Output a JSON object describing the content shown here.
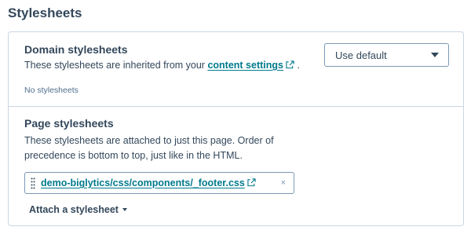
{
  "page": {
    "title": "Stylesheets"
  },
  "domain": {
    "title": "Domain stylesheets",
    "desc_prefix": "These stylesheets are inherited from your ",
    "link_text": "content settings",
    "desc_suffix": " .",
    "empty_text": "No stylesheets",
    "select_value": "Use default"
  },
  "page_styles": {
    "title": "Page stylesheets",
    "desc_line1": "These stylesheets are attached to just this page. Order of",
    "desc_line2": "precedence is bottom to top, just like in the HTML.",
    "file_path": "demo-biglytics/css/components/_footer.css",
    "remove_symbol": "×",
    "attach_label": "Attach a stylesheet"
  },
  "icons": {
    "external_link": "external-link-icon",
    "drag": "drag-handle-icon",
    "remove": "close-icon",
    "dropdown": "chevron-down-icon"
  },
  "colors": {
    "text": "#33475b",
    "link": "#007a8c",
    "border": "#cbd6e2",
    "muted": "#516f90"
  }
}
